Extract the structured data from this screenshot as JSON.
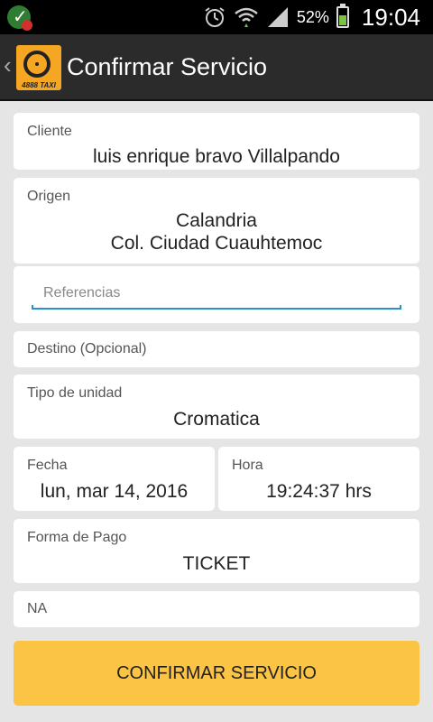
{
  "status_bar": {
    "battery_percent": "52%",
    "time": "19:04",
    "icons": [
      "app-notification-icon",
      "alarm-icon",
      "wifi-icon",
      "signal-icon",
      "battery-charging-icon"
    ]
  },
  "action_bar": {
    "title": "Confirmar Servicio",
    "logo_text": "4888 TAXI"
  },
  "form": {
    "cliente": {
      "label": "Cliente",
      "value": "luis enrique bravo Villalpando"
    },
    "origen": {
      "label": "Origen",
      "line1": "Calandria",
      "line2": "Col. Ciudad Cuauhtemoc"
    },
    "referencias": {
      "placeholder": "Referencias",
      "value": ""
    },
    "destino": {
      "label": "Destino (Opcional)"
    },
    "tipo_unidad": {
      "label": "Tipo de unidad",
      "value": "Cromatica"
    },
    "fecha": {
      "label": "Fecha",
      "value": "lun, mar 14, 2016"
    },
    "hora": {
      "label": "Hora",
      "value": "19:24:37 hrs"
    },
    "forma_pago": {
      "label": "Forma de Pago",
      "value": "TICKET"
    },
    "nota": {
      "label": "NA"
    }
  },
  "confirm_button": {
    "label": "CONFIRMAR SERVICIO"
  },
  "colors": {
    "background": "#e5e5e5",
    "action_bar": "#2b2b2b",
    "accent_button": "#fcc445",
    "input_underline": "#2a93c8"
  }
}
